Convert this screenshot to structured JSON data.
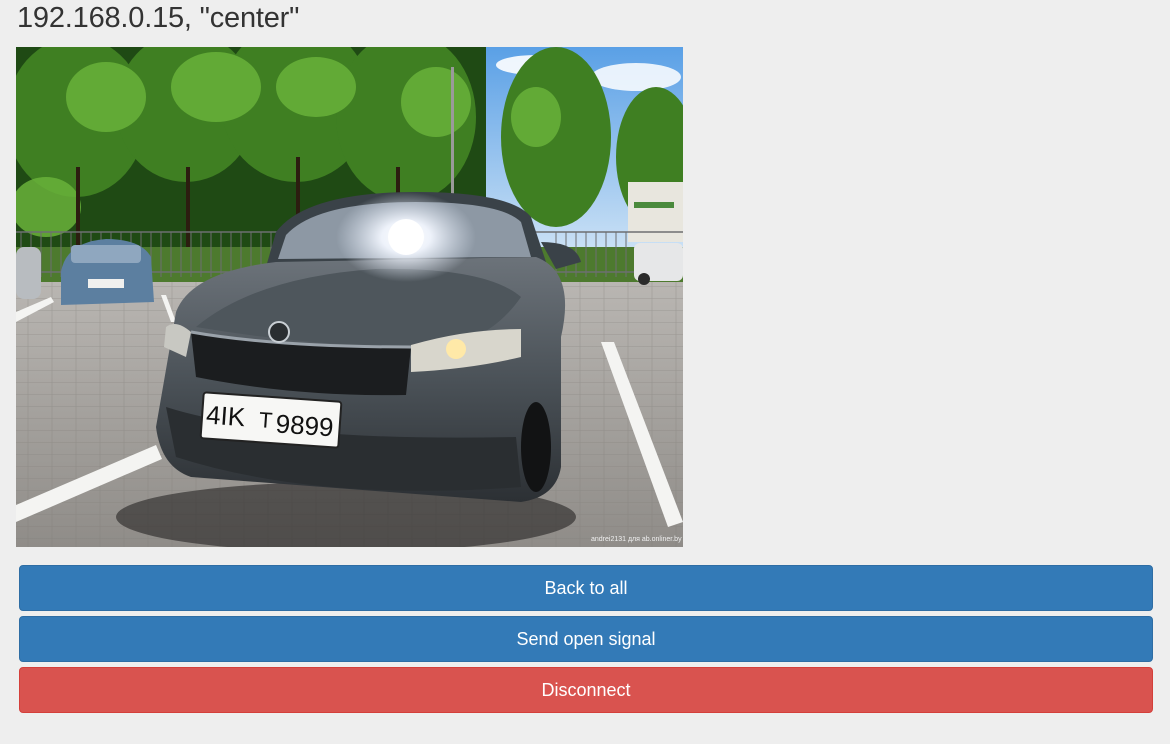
{
  "camera": {
    "title": "192.168.0.15, \"center\"",
    "image_alt": "camera snapshot",
    "plate_text_left": "4IK",
    "plate_text_mid": "T",
    "plate_text_right": "9899",
    "watermark": "andrei2131 для ab.onliner.by"
  },
  "actions": {
    "back_label": "Back to all",
    "open_label": "Send open signal",
    "disconnect_label": "Disconnect"
  },
  "colors": {
    "primary": "#337ab7",
    "danger": "#d9534f",
    "background": "#eeeeee"
  }
}
